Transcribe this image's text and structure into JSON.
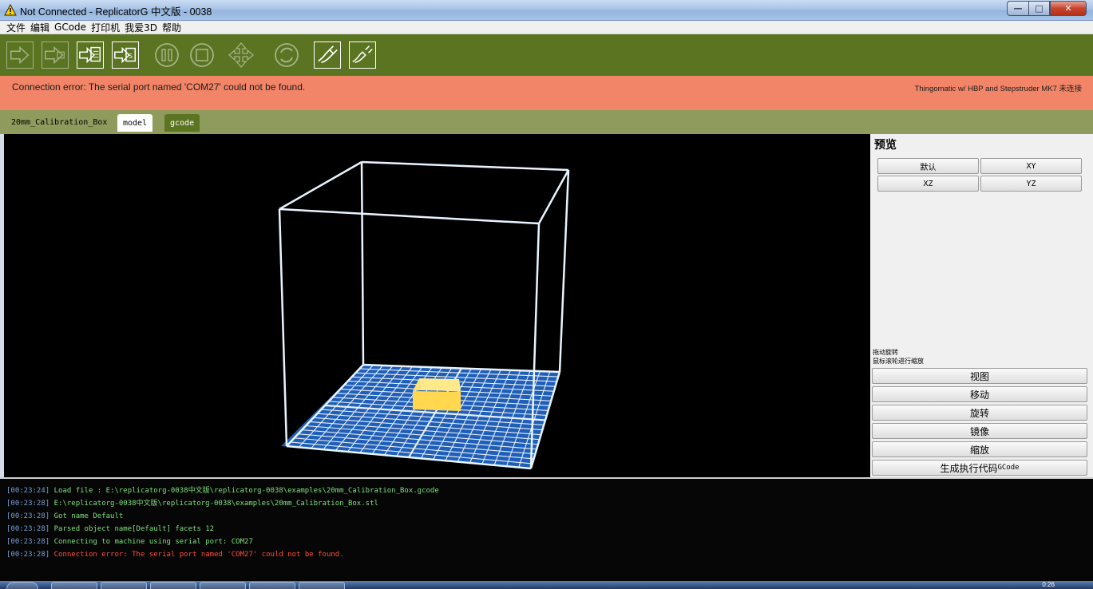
{
  "window": {
    "title": "Not Connected - ReplicatorG 中文版 - 0038",
    "buttons": {
      "minimize": "—",
      "maximize": "□",
      "close": "✕"
    }
  },
  "menu": [
    "文件",
    "编辑",
    "GCode",
    "打印机",
    "我爱3D",
    "帮助"
  ],
  "toolbar": {
    "buttons": [
      {
        "name": "build-icon",
        "enabled": false
      },
      {
        "name": "build-remote-icon",
        "enabled": false
      },
      {
        "name": "build-to-file-icon",
        "enabled": true
      },
      {
        "name": "upload-to-sd-icon",
        "enabled": true
      },
      {
        "name": "pause-icon",
        "enabled": false
      },
      {
        "name": "stop-icon",
        "enabled": false
      },
      {
        "name": "control-panel-icon",
        "enabled": false
      },
      {
        "name": "reset-icon",
        "enabled": false
      },
      {
        "name": "connect-icon",
        "enabled": true
      },
      {
        "name": "disconnect-icon",
        "enabled": true
      }
    ]
  },
  "status": {
    "message": "Connection error: The serial port named 'COM27' could not be found.",
    "machine": "Thingomatic w/ HBP and Stepstruder MK7 未连接",
    "color": "#f28568"
  },
  "tabs": {
    "file_name": "20mm_Calibration_Box",
    "model": "model",
    "gcode": "gcode"
  },
  "preview_panel": {
    "title": "预览",
    "view_buttons": [
      "默认",
      "XY",
      "XZ",
      "YZ"
    ],
    "hint_line1": "拖动旋转",
    "hint_line2": "鼠标滚轮进行缩放",
    "actions": [
      "视图",
      "移动",
      "旋转",
      "镜像",
      "缩放"
    ],
    "generate_prefix": "生成执行代码",
    "generate_suffix": "GCode"
  },
  "console": [
    {
      "time": "[00:23:24]",
      "text": "Load file : E:\\replicatorg-0038中文版\\replicatorg-0038\\examples\\20mm_Calibration_Box.gcode",
      "error": false
    },
    {
      "time": "[00:23:28]",
      "text": "E:\\replicatorg-0038中文版\\replicatorg-0038\\examples\\20mm_Calibration_Box.stl",
      "error": false
    },
    {
      "time": "[00:23:28]",
      "text": "Got name Default",
      "error": false
    },
    {
      "time": "[00:23:28]",
      "text": "Parsed object name[Default] facets 12",
      "error": false
    },
    {
      "time": "[00:23:28]",
      "text": "Connecting to machine using serial port: COM27",
      "error": false
    },
    {
      "time": "[00:23:28]",
      "text": "Connection error: The serial port named 'COM27' could not be found.",
      "error": true
    }
  ],
  "colors": {
    "toolbar": "#5b7422",
    "tabrow": "#8e9b5c",
    "grid": "#1f5fb8",
    "model": "#ffdd55",
    "console_text": "#7fe07f",
    "console_error": "#ff4d3d"
  },
  "taskbar": {
    "clock": "0:26"
  }
}
